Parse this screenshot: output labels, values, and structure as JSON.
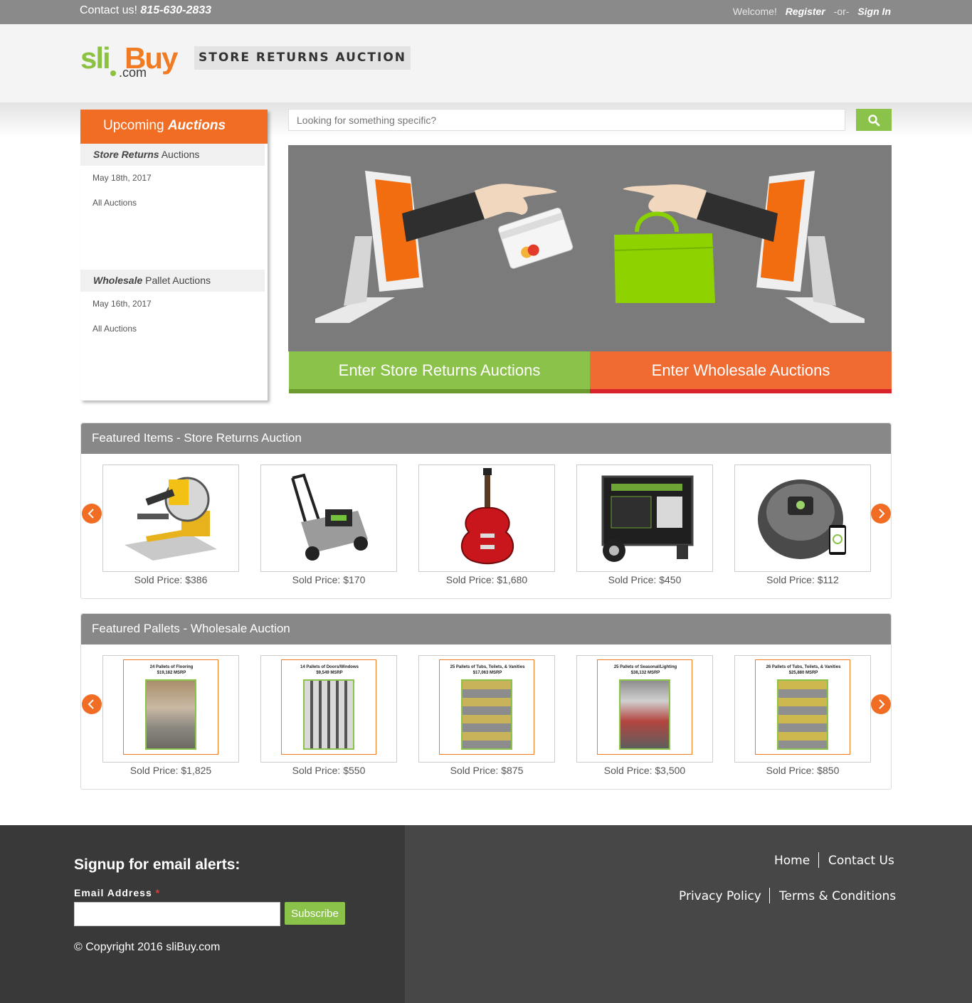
{
  "topbar": {
    "contact_label": "Contact us!",
    "phone": "815-630-2833",
    "welcome": "Welcome!",
    "register": "Register",
    "or": "-or-",
    "signin": "Sign In"
  },
  "header": {
    "logo_sli": "sli",
    "logo_buy": "Buy",
    "logo_com": ".com",
    "tagline": "STORE RETURNS AUCTION"
  },
  "sidebar": {
    "title_plain": "Upcoming",
    "title_em": "Auctions",
    "sections": [
      {
        "title_em": "Store Returns",
        "title_plain": "Auctions",
        "date": "May 18th, 2017",
        "all": "All Auctions"
      },
      {
        "title_em": "Wholesale",
        "title_plain": "Pallet Auctions",
        "date": "May 16th, 2017",
        "all": "All Auctions"
      }
    ]
  },
  "search": {
    "placeholder": "Looking for something specific?"
  },
  "banner": {
    "store_button": "Enter Store Returns Auctions",
    "wholesale_button": "Enter Wholesale Auctions"
  },
  "featured_items": {
    "title": "Featured Items - Store Returns Auction",
    "items": [
      {
        "product": "miter-saw",
        "price": "Sold Price: $386"
      },
      {
        "product": "lawn-mower",
        "price": "Sold Price: $170"
      },
      {
        "product": "electric-guitar",
        "price": "Sold Price: $1,680"
      },
      {
        "product": "generator",
        "price": "Sold Price: $450"
      },
      {
        "product": "robot-vacuum",
        "price": "Sold Price: $112"
      }
    ]
  },
  "featured_pallets": {
    "title": "Featured Pallets - Wholesale Auction",
    "items": [
      {
        "line1": "24 Pallets of Flooring",
        "line2": "$19,182 MSRP",
        "price": "Sold Price: $1,825"
      },
      {
        "line1": "14 Pallets of Doors/Windows",
        "line2": "$9,549 MSRP",
        "price": "Sold Price: $550"
      },
      {
        "line1": "25 Pallets of Tubs, Toilets, & Vanities",
        "line2": "$17,063 MSRP",
        "price": "Sold Price: $875"
      },
      {
        "line1": "25 Pallets of Seasonal/Lighting",
        "line2": "$38,132 MSRP",
        "price": "Sold Price: $3,500"
      },
      {
        "line1": "26 Pallets of Tubs, Toilets, & Vanities",
        "line2": "$25,880 MSRP",
        "price": "Sold Price: $850"
      }
    ]
  },
  "footer": {
    "signup_title": "Signup for email alerts:",
    "email_label": "Email Address",
    "required_mark": "*",
    "subscribe": "Subscribe",
    "copyright": "© Copyright 2016 sliBuy.com",
    "links": [
      "Home",
      "Contact Us",
      "Privacy Policy",
      "Terms & Conditions"
    ]
  },
  "colors": {
    "orange": "#f26d24",
    "green": "#8bc34a",
    "topbar": "#8a8a8a",
    "banner_bg": "#7b7b7b",
    "footer_left": "#393939",
    "footer_right": "#474747"
  }
}
